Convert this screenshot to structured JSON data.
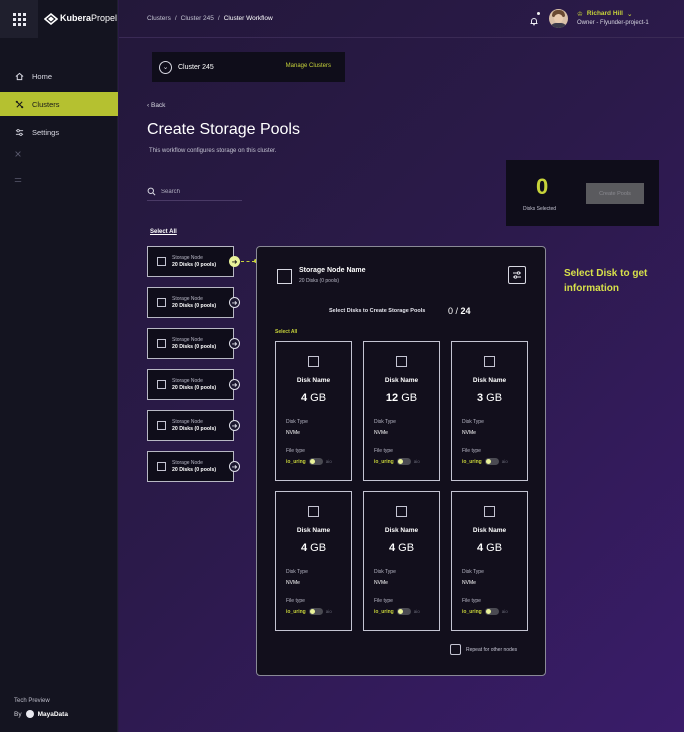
{
  "app": {
    "logo_bold": "Kubera",
    "logo_light": "Propel"
  },
  "sidebar": {
    "items": [
      {
        "label": "Home",
        "icon": "home-icon"
      },
      {
        "label": "Clusters",
        "icon": "clusters-icon",
        "active": true
      },
      {
        "label": "Settings",
        "icon": "settings-icon"
      }
    ],
    "tech_preview": "Tech Preview",
    "by_label": "By",
    "brand": "MayaData"
  },
  "header": {
    "breadcrumb": [
      "Clusters",
      "Cluster 245",
      "Cluster Workflow"
    ],
    "user_name": "Richard Hill",
    "user_role": "Owner - Flyunder-project-1"
  },
  "cluster_bar": {
    "name": "Cluster 245",
    "manage": "Manage Clusters"
  },
  "page": {
    "back": "Back",
    "title": "Create Storage Pools",
    "subtitle": "This workflow configures storage on this cluster."
  },
  "search": {
    "placeholder": "Search"
  },
  "summary": {
    "count": "0",
    "label": "Disks Selected",
    "create_button": "Create Pools"
  },
  "nodes": {
    "select_all": "Select All",
    "items": [
      {
        "label": "Storage Node",
        "sub": "20 Disks (0 pools)"
      },
      {
        "label": "Storage Node",
        "sub": "20 Disks (0 pools)"
      },
      {
        "label": "Storage Node",
        "sub": "20 Disks (0 pools)"
      },
      {
        "label": "Storage Node",
        "sub": "20 Disks (0 pools)"
      },
      {
        "label": "Storage Node",
        "sub": "20 Disks (0 pools)"
      },
      {
        "label": "Storage Node",
        "sub": "20 Disks (0 pools)"
      }
    ]
  },
  "panel": {
    "title": "Storage Node Name",
    "sub": "20 Disks (0 pools)",
    "select_text": "Select Disks to Create Storage Pools",
    "selected": "0",
    "total": "24",
    "select_all": "Select All",
    "repeat": "Repeat for other nodes",
    "disks": [
      {
        "name": "Disk Name",
        "size": "4",
        "unit": "GB",
        "type_label": "Disk Type",
        "type": "NVMe",
        "file_label": "File type",
        "io": "io_uring",
        "aio": "aio"
      },
      {
        "name": "Disk Name",
        "size": "12",
        "unit": "GB",
        "type_label": "Disk Type",
        "type": "NVMe",
        "file_label": "File type",
        "io": "io_uring",
        "aio": "aio"
      },
      {
        "name": "Disk Name",
        "size": "3",
        "unit": "GB",
        "type_label": "Disk Type",
        "type": "NVMe",
        "file_label": "File type",
        "io": "io_uring",
        "aio": "aio"
      },
      {
        "name": "Disk Name",
        "size": "4",
        "unit": "GB",
        "type_label": "Disk Type",
        "type": "NVMe",
        "file_label": "File type",
        "io": "io_uring",
        "aio": "aio"
      },
      {
        "name": "Disk Name",
        "size": "4",
        "unit": "GB",
        "type_label": "Disk Type",
        "type": "NVMe",
        "file_label": "File type",
        "io": "io_uring",
        "aio": "aio"
      },
      {
        "name": "Disk Name",
        "size": "4",
        "unit": "GB",
        "type_label": "Disk Type",
        "type": "NVMe",
        "file_label": "File type",
        "io": "io_uring",
        "aio": "aio"
      }
    ]
  },
  "hint": "Select Disk to get information",
  "colors": {
    "accent": "#c7d33a",
    "sidebar_bg": "#141420",
    "panel_bg": "#120f1c"
  }
}
